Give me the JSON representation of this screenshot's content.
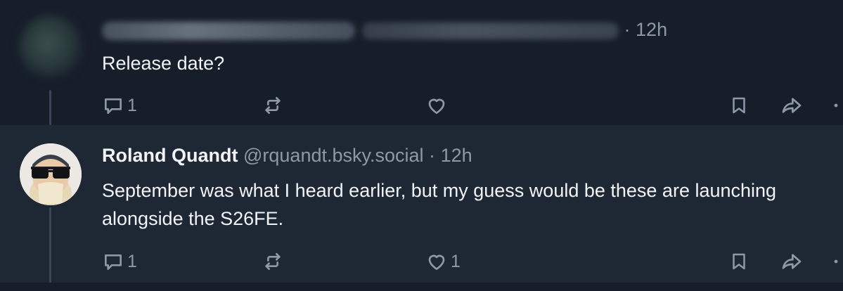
{
  "posts": [
    {
      "author_name": "",
      "author_handle": "",
      "separator": "·",
      "timestamp": "12h",
      "text": "Release date?",
      "reply_count": "1",
      "repost_count": "",
      "like_count": "",
      "author_obscured": true
    },
    {
      "author_name": "Roland Quandt",
      "author_handle": "@rquandt.bsky.social",
      "separator": "·",
      "timestamp": "12h",
      "text": "September was what I heard earlier, but my guess would be these are launching alongside the S26FE.",
      "reply_count": "1",
      "repost_count": "",
      "like_count": "1",
      "author_obscured": false
    }
  ],
  "icons": {
    "reply": "speech-bubble-icon",
    "repost": "repost-arrows-icon",
    "like": "heart-icon",
    "bookmark": "bookmark-icon",
    "share": "share-arrow-icon",
    "more": "more-dots-icon"
  },
  "colors": {
    "background": "#161e29",
    "highlighted_post": "#1e2835",
    "text_primary": "#f1f3f5",
    "text_muted": "#8e99a7",
    "thread_line": "#3a4656"
  }
}
